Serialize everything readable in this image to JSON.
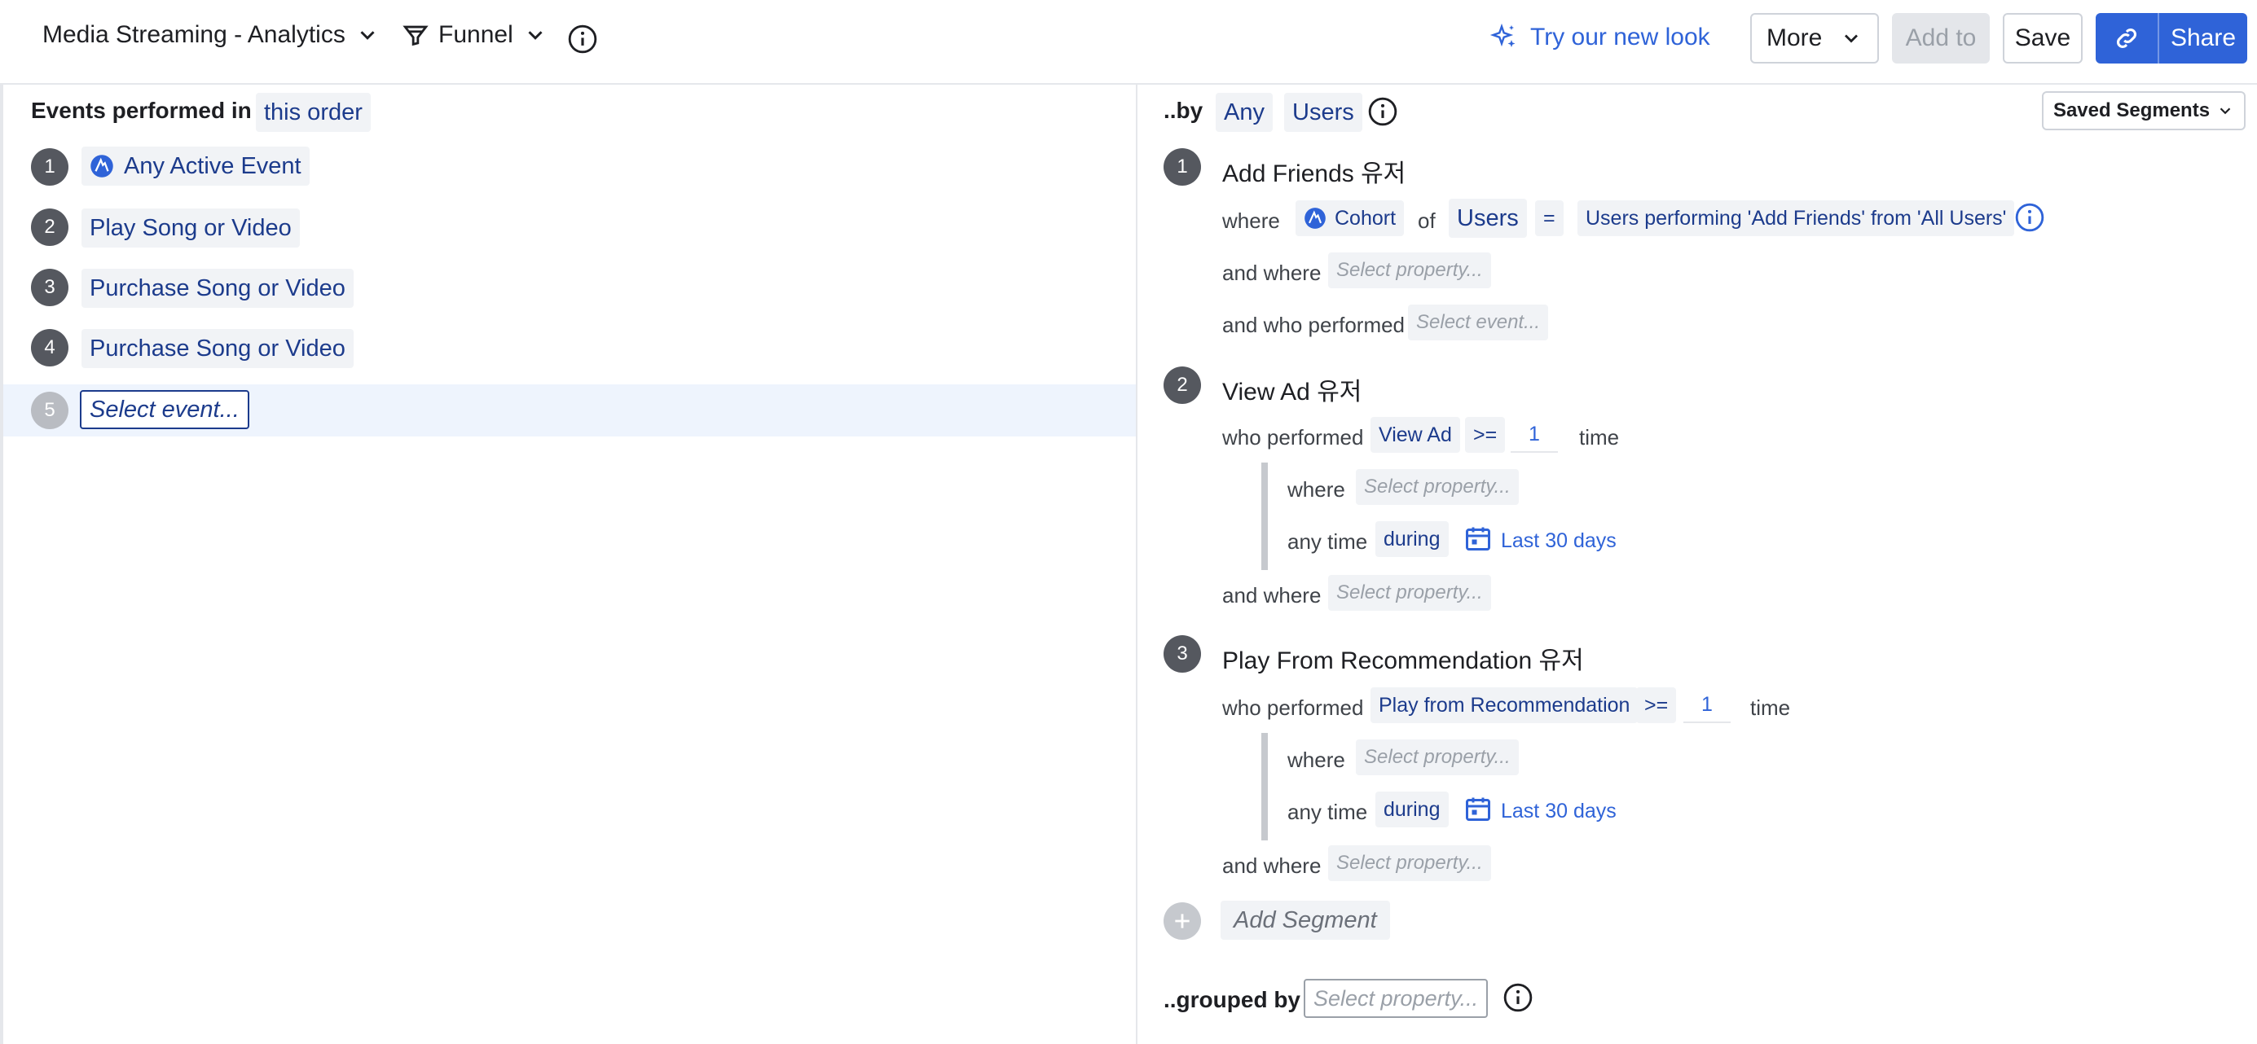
{
  "topbar": {
    "project": "Media Streaming - Analytics",
    "chart_type": "Funnel",
    "try_new_look": "Try our new look",
    "more": "More",
    "add_to": "Add to",
    "save": "Save",
    "share": "Share"
  },
  "events": {
    "heading": "Events performed in",
    "order": "this order",
    "items": [
      {
        "num": "1",
        "label": "Any Active Event"
      },
      {
        "num": "2",
        "label": "Play Song or Video"
      },
      {
        "num": "3",
        "label": "Purchase Song or Video"
      },
      {
        "num": "4",
        "label": "Purchase Song or Video"
      },
      {
        "num": "5",
        "label": "Select event..."
      }
    ]
  },
  "segments": {
    "by": "..by",
    "any": "Any",
    "users": "Users",
    "saved": "Saved Segments",
    "items": [
      {
        "num": "1",
        "title": "Add Friends 유저",
        "where": "where",
        "cohort": "Cohort",
        "of": "of",
        "users": "Users",
        "eq": "=",
        "cohort_value": "Users performing 'Add Friends' from 'All Users'",
        "and_where": "and where",
        "select_property": "Select property...",
        "and_who_performed": "and who performed",
        "select_event": "Select event..."
      },
      {
        "num": "2",
        "title": "View Ad 유저",
        "who_performed": "who performed",
        "event": "View Ad",
        "op": ">=",
        "count": "1",
        "time": "time",
        "where": "where",
        "select_property": "Select property...",
        "any_time": "any time",
        "during": "during",
        "range": "Last 30 days",
        "and_where": "and where",
        "select_property2": "Select property..."
      },
      {
        "num": "3",
        "title": "Play From Recommendation 유저",
        "who_performed": "who performed",
        "event": "Play from Recommendation",
        "op": ">=",
        "count": "1",
        "time": "time",
        "where": "where",
        "select_property": "Select property...",
        "any_time": "any time",
        "during": "during",
        "range": "Last 30 days",
        "and_where": "and where",
        "select_property2": "Select property..."
      }
    ],
    "add_segment": "Add Segment",
    "grouped_by": "..grouped by",
    "grouped_placeholder": "Select property..."
  },
  "colors": {
    "accent": "#2f63d8",
    "chip_text": "#1c3b8c",
    "badge": "#55585f"
  }
}
